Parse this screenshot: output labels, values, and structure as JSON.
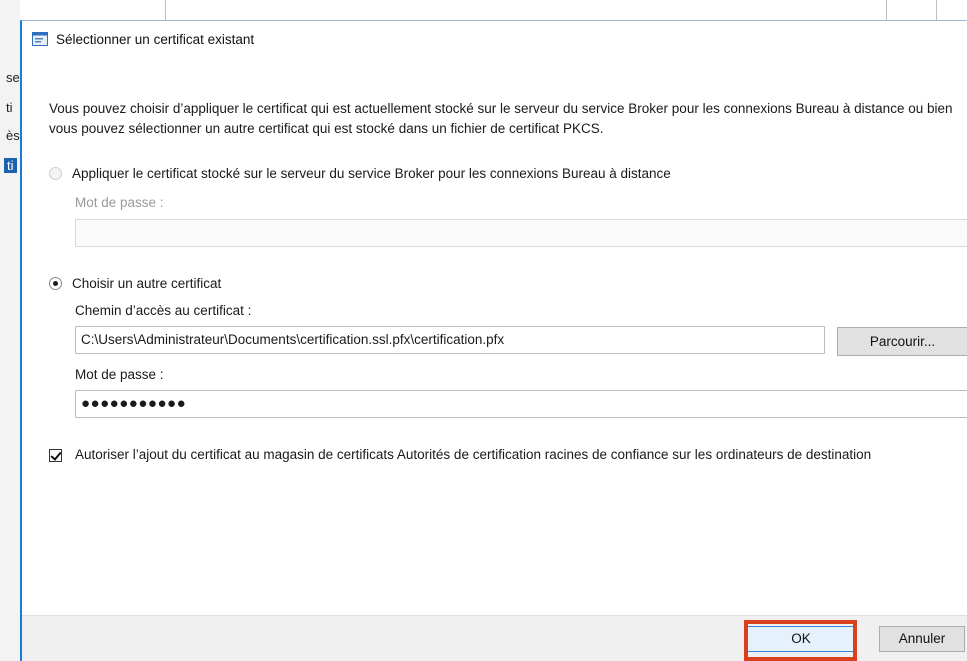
{
  "background": {
    "fragments": [
      "se",
      "ti",
      "ès",
      "ti"
    ]
  },
  "dialog": {
    "title": "Sélectionner un certificat existant",
    "title_icon": "certificate-window-icon",
    "intro": "Vous pouvez choisir d’appliquer le certificat qui est actuellement stocké sur le serveur du service Broker pour les connexions Bureau à distance ou bien vous pouvez sélectionner un autre certificat qui est stocké dans un fichier de certificat PKCS.",
    "option_broker": {
      "label": "Appliquer le certificat stocké sur le serveur du service Broker pour les connexions Bureau à distance",
      "selected": false,
      "password_label": "Mot de passe :",
      "password_value": ""
    },
    "option_other": {
      "label": "Choisir un autre certificat",
      "selected": true,
      "path_label": "Chemin d’accès au certificat :",
      "path_value": "C:\\Users\\Administrateur\\Documents\\certification.ssl.pfx\\certification.pfx",
      "browse_label": "Parcourir...",
      "password_label": "Mot de passe :",
      "password_value": "●●●●●●●●●●●"
    },
    "trust_checkbox": {
      "label": "Autoriser l’ajout du certificat au magasin de certificats Autorités de certification racines de confiance sur les ordinateurs de destination",
      "checked": true
    },
    "buttons": {
      "ok": "OK",
      "cancel": "Annuler"
    },
    "colors": {
      "accent_border": "#1e78d6",
      "highlight": "#d9411e"
    }
  }
}
